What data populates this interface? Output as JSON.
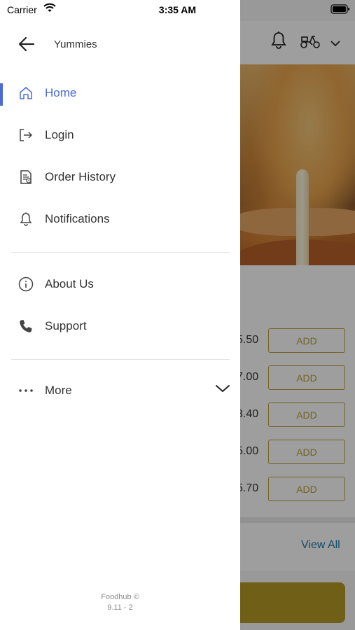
{
  "status_bar": {
    "carrier": "Carrier",
    "time": "3:35 AM"
  },
  "drawer": {
    "store_name": "Yummies",
    "menu_primary": [
      {
        "label": "Home",
        "icon": "home-icon",
        "active": true
      },
      {
        "label": "Login",
        "icon": "login-icon"
      },
      {
        "label": "Order History",
        "icon": "order-history-icon"
      },
      {
        "label": "Notifications",
        "icon": "bell-icon"
      }
    ],
    "menu_secondary": [
      {
        "label": "About Us",
        "icon": "info-icon"
      },
      {
        "label": "Support",
        "icon": "phone-icon"
      }
    ],
    "more": {
      "label": "More",
      "icon": "more-dots-icon"
    },
    "footer": {
      "brand": "Foodhub ©",
      "version": "9.11 - 2"
    }
  },
  "background": {
    "prices": [
      "5.50",
      "7.00",
      "3.40",
      "5.00",
      "5.70"
    ],
    "add_label": "ADD",
    "view_all": "View All"
  },
  "colors": {
    "accent": "#4a6bd6",
    "add_button": "#b7a23a",
    "view_all": "#1f7aa8",
    "cta": "#b59a24"
  }
}
